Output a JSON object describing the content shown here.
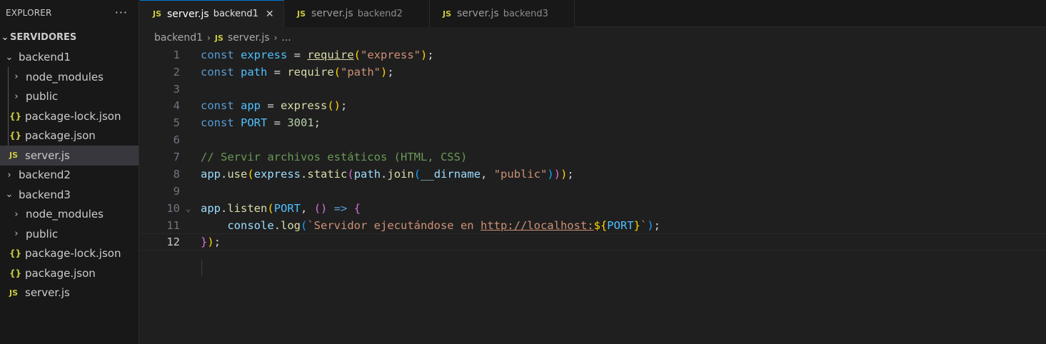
{
  "sidebar": {
    "title": "EXPLORER",
    "more": "···",
    "section": "SERVIDORES",
    "tree": [
      {
        "label": "backend1",
        "kind": "folder",
        "open": true,
        "depth": 0
      },
      {
        "label": "node_modules",
        "kind": "folder",
        "open": false,
        "depth": 1
      },
      {
        "label": "public",
        "kind": "folder",
        "open": false,
        "depth": 1
      },
      {
        "label": "package-lock.json",
        "kind": "json",
        "depth": 1
      },
      {
        "label": "package.json",
        "kind": "json",
        "depth": 1
      },
      {
        "label": "server.js",
        "kind": "js",
        "depth": 1,
        "selected": true
      },
      {
        "label": "backend2",
        "kind": "folder",
        "open": false,
        "depth": 0
      },
      {
        "label": "backend3",
        "kind": "folder",
        "open": true,
        "depth": 0
      },
      {
        "label": "node_modules",
        "kind": "folder",
        "open": false,
        "depth": 1
      },
      {
        "label": "public",
        "kind": "folder",
        "open": false,
        "depth": 1
      },
      {
        "label": "package-lock.json",
        "kind": "json",
        "depth": 1
      },
      {
        "label": "package.json",
        "kind": "json",
        "depth": 1
      },
      {
        "label": "server.js",
        "kind": "js",
        "depth": 1
      }
    ]
  },
  "tabs": [
    {
      "icon": "JS",
      "name": "server.js",
      "desc": "backend1",
      "active": true,
      "close": "✕"
    },
    {
      "icon": "JS",
      "name": "server.js",
      "desc": "backend2",
      "active": false
    },
    {
      "icon": "JS",
      "name": "server.js",
      "desc": "backend3",
      "active": false
    }
  ],
  "breadcrumb": {
    "folder": "backend1",
    "file_icon": "JS",
    "file": "server.js",
    "more": "..."
  },
  "editor": {
    "current_line": 12,
    "line_numbers": [
      "1",
      "2",
      "3",
      "4",
      "5",
      "6",
      "7",
      "8",
      "9",
      "10",
      "11",
      "12"
    ],
    "lines": {
      "l1": [
        "const",
        " ",
        "express",
        " = ",
        "require",
        "(",
        "\"express\"",
        ")",
        ";"
      ],
      "l2": [
        "const",
        " ",
        "path",
        " = ",
        "require",
        "(",
        "\"path\"",
        ")",
        ";"
      ],
      "l4": [
        "const",
        " ",
        "app",
        " = ",
        "express",
        "()",
        ";"
      ],
      "l5": [
        "const",
        " ",
        "PORT",
        " = ",
        "3001",
        ";"
      ],
      "l7": "// Servir archivos estáticos (HTML, CSS)",
      "l8": [
        "app",
        ".",
        "use",
        "(",
        "express",
        ".",
        "static",
        "(",
        "path",
        ".",
        "join",
        "(",
        "__dirname",
        ", ",
        "\"public\"",
        ")",
        ")",
        ")",
        ";"
      ],
      "l10": [
        "app",
        ".",
        "listen",
        "(",
        "PORT",
        ", ",
        "()",
        " ",
        "=>",
        " ",
        "{"
      ],
      "l11": [
        "    ",
        "console",
        ".",
        "log",
        "(",
        "`Servidor ejecutándose en ",
        "http://localhost:",
        "${",
        "PORT",
        "}",
        "`",
        ")",
        ";"
      ],
      "l12": [
        "}",
        ")",
        ";"
      ]
    }
  },
  "icons": {
    "chevron_right": "chevron-right-icon",
    "chevron_down": "chevron-down-icon",
    "json_file": "json-file-icon",
    "js_file": "js-file-icon"
  },
  "colors": {
    "keyword": "#569cd6",
    "variable": "#9cdcfe",
    "constant": "#4fc1ff",
    "function": "#dcdcaa",
    "string": "#ce9178",
    "number": "#b5cea8",
    "comment": "#6a9955",
    "js_icon": "#cbcb41",
    "active_tab_border": "#0078d4"
  }
}
